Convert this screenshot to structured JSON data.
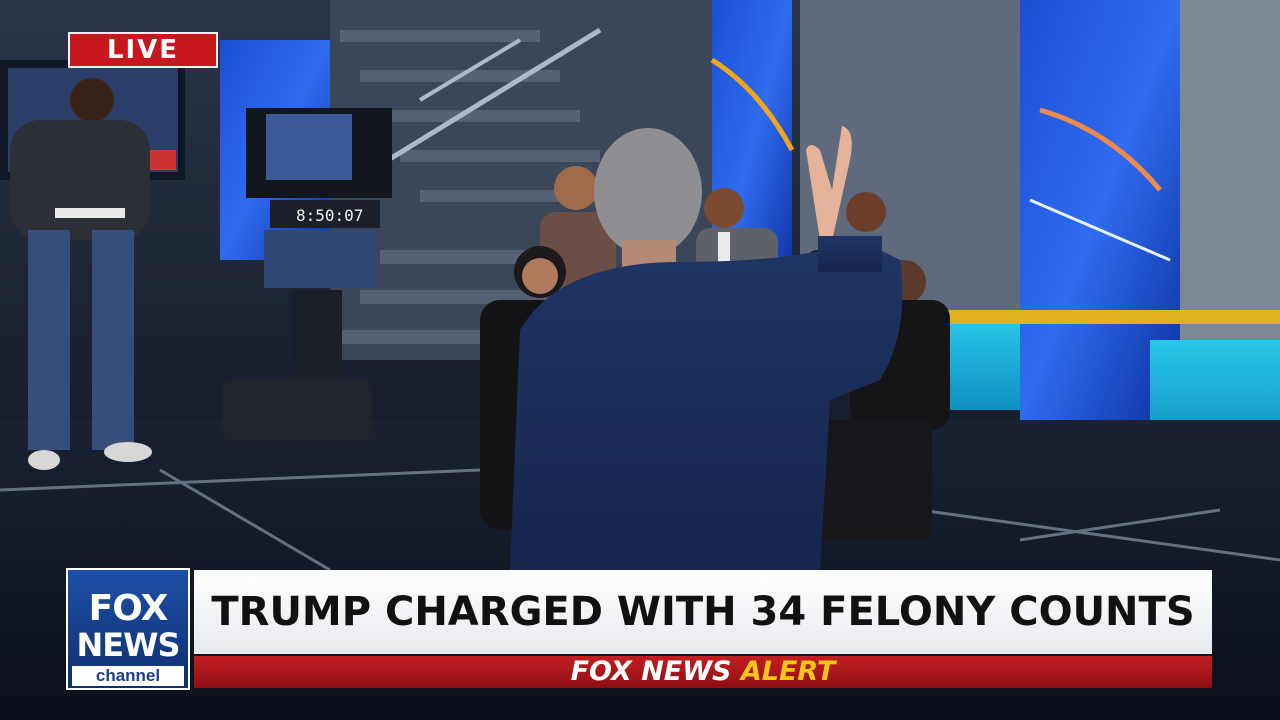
{
  "badge": {
    "live": "LIVE"
  },
  "lower_third": {
    "logo": {
      "line1": "FOX",
      "line2": "NEWS",
      "line3": "channel"
    },
    "headline": "TRUMP CHARGED WITH 34 FELONY COUNTS",
    "alert": {
      "brand": "FOX NEWS",
      "word": "ALERT"
    }
  },
  "colors": {
    "live_red": "#c8171e",
    "fox_blue": "#1d4fa8",
    "alert_red": "#c41e22",
    "alert_yellow": "#f5c518"
  },
  "studio": {
    "monitor_clock": "8:50:07"
  }
}
